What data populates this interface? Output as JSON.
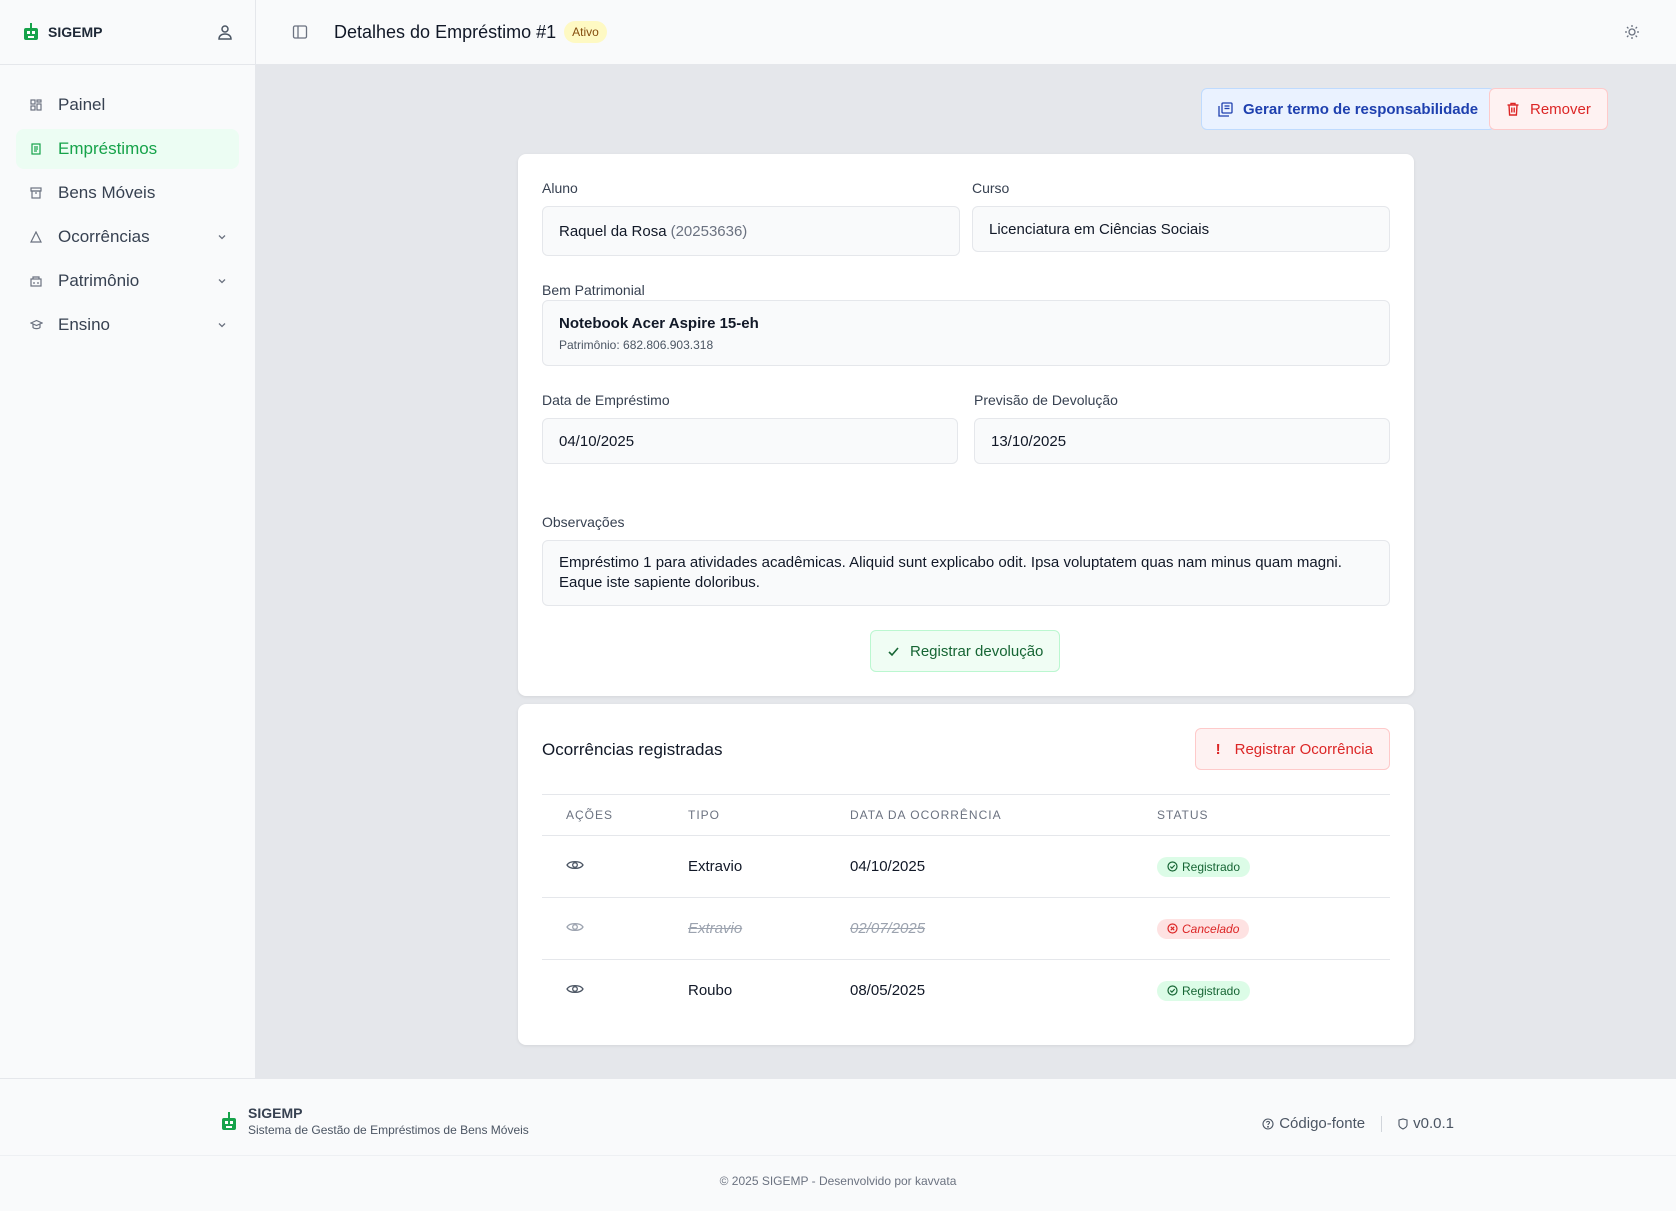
{
  "app": {
    "name": "SIGEMP"
  },
  "sidebar": {
    "items": [
      {
        "label": "Painel"
      },
      {
        "label": "Empréstimos"
      },
      {
        "label": "Bens Móveis"
      },
      {
        "label": "Ocorrências"
      },
      {
        "label": "Patrimônio"
      },
      {
        "label": "Ensino"
      }
    ]
  },
  "header": {
    "title": "Detalhes do Empréstimo #1",
    "status_badge": "Ativo"
  },
  "actions": {
    "term_label": "Gerar termo de responsabilidade",
    "remove_label": "Remover"
  },
  "loan": {
    "student_label": "Aluno",
    "student_name": "Raquel da Rosa",
    "student_id": "(20253636)",
    "course_label": "Curso",
    "course": "Licenciatura em Ciências Sociais",
    "asset_label": "Bem Patrimonial",
    "asset_name": "Notebook Acer Aspire 15-eh",
    "asset_patrimony": "Patrimônio: 682.806.903.318",
    "loan_date_label": "Data de Empréstimo",
    "loan_date": "04/10/2025",
    "return_label": "Previsão de Devolução",
    "return_date": "13/10/2025",
    "notes_label": "Observações",
    "notes_line1": "Empréstimo 1 para atividades acadêmicas. Aliquid sunt explicabo odit. Ipsa voluptatem quas nam minus quam magni.",
    "notes_line2": "Eaque iste sapiente doloribus.",
    "register_return_label": "Registrar devolução"
  },
  "occurrences": {
    "title": "Ocorrências registradas",
    "register_label": "Registrar Ocorrência",
    "columns": [
      "AÇÕES",
      "TIPO",
      "DATA DA OCORRÊNCIA",
      "STATUS"
    ],
    "rows": [
      {
        "type": "Extravio",
        "date": "04/10/2025",
        "status": "Registrado"
      },
      {
        "type": "Extravio",
        "date": "02/07/2025",
        "status": "Cancelado"
      },
      {
        "type": "Roubo",
        "date": "08/05/2025",
        "status": "Registrado"
      }
    ]
  },
  "footer": {
    "name": "SIGEMP",
    "description": "Sistema de Gestão de Empréstimos de Bens Móveis",
    "source_label": "Código-fonte",
    "version": "v0.0.1",
    "copyright": "© 2025 SIGEMP - Desenvolvido por kavvata"
  },
  "colors": {
    "accent_green": "#16a34a",
    "danger": "#dc2626",
    "info": "#1e40af",
    "warning_bg": "#fef9c3"
  }
}
